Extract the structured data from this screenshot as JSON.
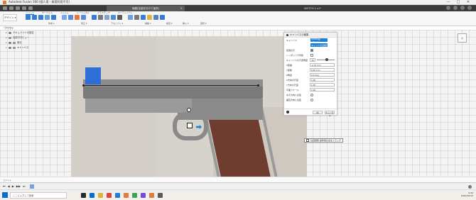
{
  "window": {
    "title": "Autodesk Fusion 360 (個人用 - 商用利用不可)",
    "controls": [
      "—",
      "□",
      "✕"
    ]
  },
  "tabs": {
    "active": "無題(名前を付けて保存)",
    "other": "SKETCH 1 v1*"
  },
  "ribbon": {
    "workspace_label": "デザイン ▾",
    "tool_tabs": [
      "ソリッド",
      "サーフェス",
      "メッシュ",
      "シートメタル",
      "プラスチック",
      "ユーティリティ"
    ],
    "active_tab": "ソリッド",
    "groups": [
      "作成 ▾",
      "修正 ▾",
      "アセンブリ ▾",
      "構築 ▾",
      "検査 ▾",
      "挿入 ▾",
      "選択 ▾"
    ],
    "tool_colors": [
      "#3a7bd5",
      "#3a7bd5",
      "#3a7bd5",
      "#6a9fe0",
      "#3a7bd5",
      "#7aa8e8",
      "#5b8ad6",
      "#e07b39",
      "#5b8ad6",
      "#3a7bd5",
      "#7a7a7a",
      "#8aa2c8",
      "#4a8fd8",
      "#5a5a5a",
      "#6aa0e0",
      "#7a7a7a",
      "#3a7bd5",
      "#e2b33c",
      "#5a7fc0",
      "#3a7bd5"
    ]
  },
  "breadcrumb": "ブラウザ",
  "browser": {
    "header": "ブラウザ",
    "items": [
      {
        "label": "ドキュメントの設定"
      },
      {
        "label": "名前付きビュー"
      },
      {
        "label": "原点"
      },
      {
        "label": "キャンバス"
      }
    ]
  },
  "dialog": {
    "title": "キャンバスの編集",
    "rows": [
      {
        "label": "キャンバス",
        "type": "select",
        "value": "2016年版1911.jpg"
      },
      {
        "label": "",
        "type": "select",
        "value": "キャンバスを選択"
      },
      {
        "label": "透過表示",
        "type": "checkbox",
        "checked": true
      },
      {
        "label": "レンダリング対象",
        "type": "checkbox",
        "checked": false
      },
      {
        "label": "キャンバスの不透明度",
        "type": "slider",
        "value": "50"
      },
      {
        "label": "X距離",
        "type": "input",
        "value": "-2.70 mm"
      },
      {
        "label": "Y距離",
        "type": "input",
        "value": "9.56 mm"
      },
      {
        "label": "Z角度",
        "type": "input",
        "value": "0.0 deg"
      },
      {
        "label": "X方向の尺度",
        "type": "input",
        "value": "1.00"
      },
      {
        "label": "Y方向の尺度",
        "type": "input",
        "value": "1.00"
      },
      {
        "label": "平面スケール",
        "type": "input",
        "value": "1.00"
      },
      {
        "label": "水平方向に反転",
        "type": "radio"
      },
      {
        "label": "垂直方向に反転",
        "type": "radio"
      }
    ],
    "ok_label": "OK",
    "cancel_label": "キャンセル"
  },
  "tooltip": "位置調整 操作用の点をドラッグ",
  "viewcube_label": "前",
  "comments_label": "コメント",
  "timeline": {
    "controls": [
      "⏮",
      "◀",
      "▶",
      "▶▶",
      "⏭"
    ]
  },
  "taskbar": {
    "search_placeholder": "ここに入力して検索",
    "time": "9:30",
    "date": "2020/09/13",
    "app_colors": [
      "#2a2a2a",
      "#0a6ed1",
      "#e2b33c",
      "#d9473f",
      "#1c7fd6",
      "#e07b39",
      "#3aa457",
      "#7a4ad6",
      "#e07b39",
      "#5a5a5a"
    ]
  }
}
